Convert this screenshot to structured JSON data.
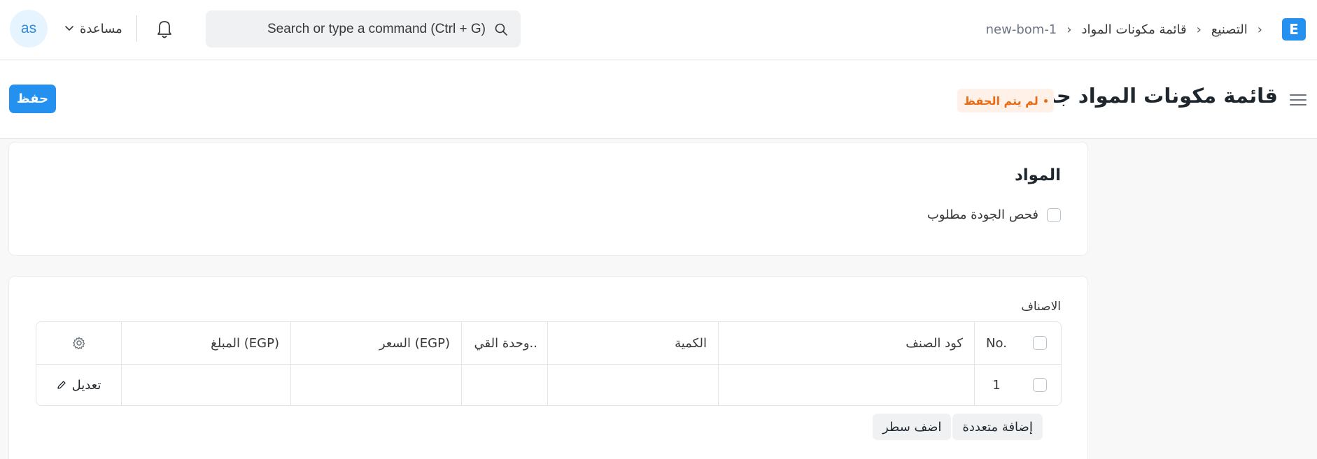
{
  "navbar": {
    "logo_letter": "E",
    "breadcrumbs": [
      "التصنيع",
      "قائمة مكونات المواد",
      "new-bom-1"
    ],
    "search_placeholder": "Search or type a command (Ctrl + G)",
    "help_label": "مساعدة",
    "avatar_initials": "as"
  },
  "page": {
    "title": "قائمة مكونات المواد جديد",
    "status_badge": "لم يتم الحفظ",
    "save_label": "حفظ"
  },
  "materials_section": {
    "title": "المواد",
    "quality_check_label": "فحص الجودة مطلوب"
  },
  "items_table": {
    "label": "الاصناف",
    "columns": {
      "no": "No.",
      "item_code": "كود الصنف",
      "qty": "الكمية",
      "uom": "وحدة القي..",
      "rate": "السعر (EGP)",
      "amount": "المبلغ (EGP)"
    },
    "rows": [
      {
        "no": "1",
        "item_code": "",
        "qty": "",
        "uom": "",
        "rate": "",
        "amount": "",
        "edit_label": "تعديل"
      }
    ],
    "add_multiple_label": "إضافة متعددة",
    "add_row_label": "اضف سطر"
  },
  "colors": {
    "primary": "#2490ef",
    "badge_bg": "#fff1e7",
    "badge_text": "#e86c13"
  }
}
